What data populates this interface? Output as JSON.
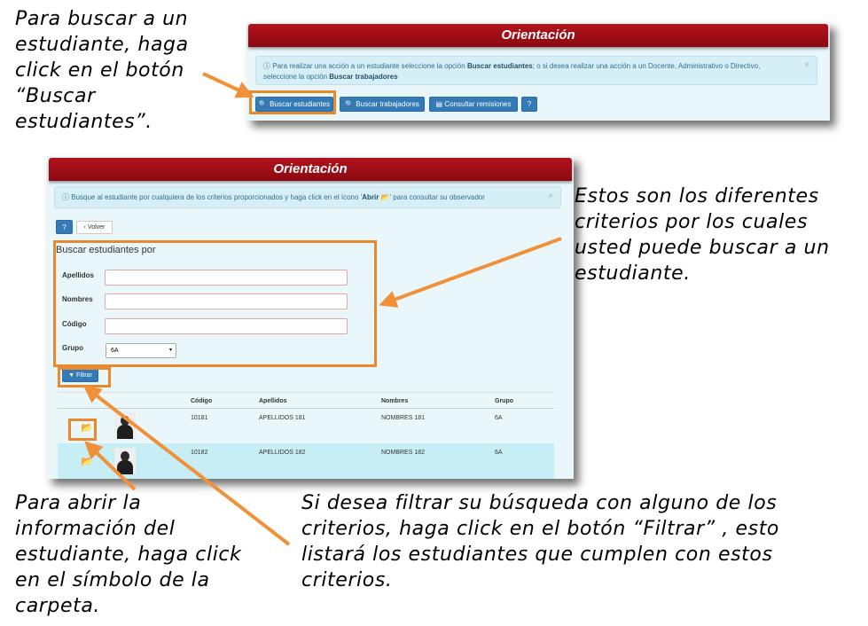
{
  "captions": {
    "top_left": "Para buscar a un\nestudiante, haga\nclick en el botón\n“Buscar\nestudiantes”.",
    "right": "Estos son los diferentes\ncriterios por los cuales\nusted puede buscar a un\nestudiante.",
    "bottom_left": "Para abrir la\ninformación del\nestudiante, haga click\nen el símbolo de la\ncarpeta.",
    "bottom_right": "Si desea filtrar su búsqueda con alguno de los\ncriterios, haga click en el botón “Filtrar” , esto\nlistará los estudiantes que cumplen con estos\ncriterios."
  },
  "panel1": {
    "title": "Orientación",
    "alert_prefix": "Para realizar una acción a un estudiante seleccione la opción ",
    "alert_bold1": "Buscar estudiantes",
    "alert_middle": "; o si desea realizar una acción a un Docente, Administrativo o Directivo,",
    "alert_line2": "seleccione la opción ",
    "alert_bold2": "Buscar trabajadores",
    "buttons": {
      "buscar_estudiantes": "Buscar estudiantes",
      "buscar_trabajadores": "Buscar trabajadores",
      "consultar_remisiones": "Consultar remisiones",
      "help": "?"
    }
  },
  "panel2": {
    "title": "Orientación",
    "alert_prefix": "Busque al estudiante por cualquiera de los criterios proporcionados y haga click en el ícono '",
    "alert_bold": "Abrir",
    "alert_suffix": "' para consultar su observador",
    "back_button": "Volver",
    "help_button": "?",
    "form_title": "Buscar estudiantes por",
    "labels": {
      "apellidos": "Apellidos",
      "nombres": "Nombres",
      "codigo": "Código",
      "grupo": "Grupo"
    },
    "grupo_selected": "6A",
    "filter_button": "Filtrar",
    "table": {
      "headers": [
        "Código",
        "Apellidos",
        "Nombres",
        "Grupo"
      ],
      "rows": [
        {
          "codigo": "10181",
          "apellidos": "APELLIDOS 181",
          "nombres": "NOMBRES 181",
          "grupo": "6A"
        },
        {
          "codigo": "10182",
          "apellidos": "APELLIDOS 182",
          "nombres": "NOMBRES 182",
          "grupo": "6A"
        }
      ]
    }
  },
  "colors": {
    "header_red": "#9b0d15",
    "accent_orange": "#e8892d",
    "button_blue": "#337ab7",
    "panel_bg": "#e9f7fb"
  },
  "icons": [
    "info-circle-icon",
    "search-icon",
    "table-icon",
    "question-icon",
    "chevron-left-icon",
    "filter-icon",
    "folder-open-icon",
    "close-icon",
    "caret-down-icon"
  ]
}
